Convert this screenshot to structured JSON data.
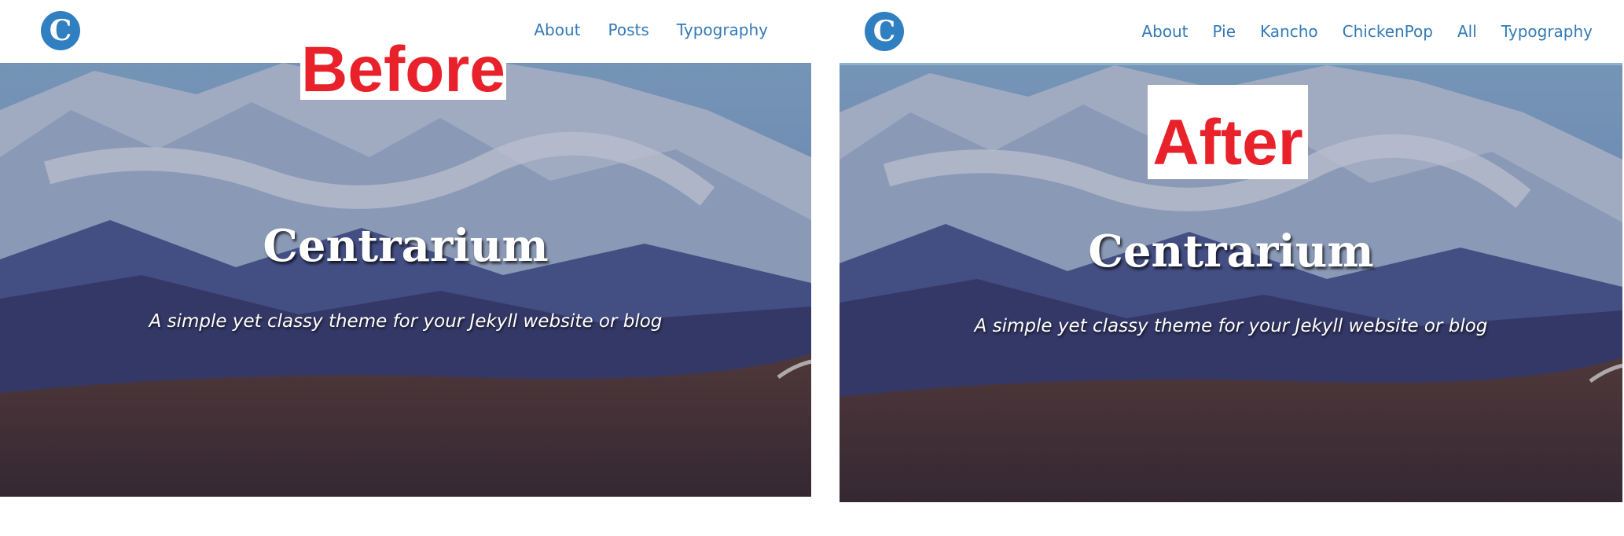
{
  "before": {
    "logo_letter": "C",
    "nav": [
      "About",
      "Posts",
      "Typography"
    ],
    "hero": {
      "title": "Centrarium",
      "subtitle": "A simple yet classy theme for your Jekyll website or blog"
    },
    "label": "Before"
  },
  "after": {
    "logo_letter": "C",
    "nav": [
      "About",
      "Pie",
      "Kancho",
      "ChickenPop",
      "All",
      "Typography"
    ],
    "hero": {
      "title": "Centrarium",
      "subtitle": "A simple yet classy theme for your Jekyll website or blog"
    },
    "label": "After"
  },
  "colors": {
    "nav_link": "#337ab7",
    "logo": "#2f7fc1",
    "annotation": "#e8212a"
  }
}
